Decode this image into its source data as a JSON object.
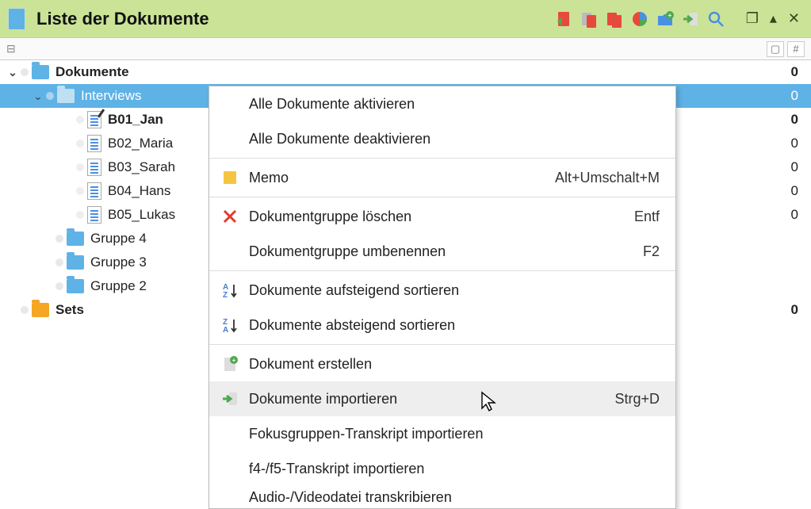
{
  "header": {
    "title": "Liste der Dokumente"
  },
  "tree": {
    "root": {
      "label": "Dokumente",
      "count": "0"
    },
    "interviews": {
      "label": "Interviews",
      "count": "0"
    },
    "docs": [
      {
        "label": "B01_Jan",
        "count": "0",
        "bold": true,
        "edit": true
      },
      {
        "label": "B02_Maria",
        "count": "0"
      },
      {
        "label": "B03_Sarah",
        "count": "0"
      },
      {
        "label": "B04_Hans",
        "count": "0"
      },
      {
        "label": "B05_Lukas",
        "count": "0"
      }
    ],
    "groups": [
      {
        "label": "Gruppe 4"
      },
      {
        "label": "Gruppe 3"
      },
      {
        "label": "Gruppe 2"
      }
    ],
    "sets": {
      "label": "Sets",
      "count": "0"
    }
  },
  "context_menu": {
    "items": [
      {
        "label": "Alle Dokumente aktivieren",
        "shortcut": "",
        "icon": ""
      },
      {
        "label": "Alle Dokumente deaktivieren",
        "shortcut": "",
        "icon": ""
      },
      {
        "sep": true
      },
      {
        "label": "Memo",
        "shortcut": "Alt+Umschalt+M",
        "icon": "memo"
      },
      {
        "sep": true
      },
      {
        "label": "Dokumentgruppe löschen",
        "shortcut": "Entf",
        "icon": "delete"
      },
      {
        "label": "Dokumentgruppe umbenennen",
        "shortcut": "F2",
        "icon": ""
      },
      {
        "sep": true
      },
      {
        "label": "Dokumente aufsteigend sortieren",
        "shortcut": "",
        "icon": "sort-asc"
      },
      {
        "label": "Dokumente absteigend sortieren",
        "shortcut": "",
        "icon": "sort-desc"
      },
      {
        "sep": true
      },
      {
        "label": "Dokument erstellen",
        "shortcut": "",
        "icon": "new-doc"
      },
      {
        "label": "Dokumente importieren",
        "shortcut": "Strg+D",
        "icon": "import",
        "highlight": true
      },
      {
        "label": "Fokusgruppen-Transkript importieren",
        "shortcut": "",
        "icon": ""
      },
      {
        "label": "f4-/f5-Transkript importieren",
        "shortcut": "",
        "icon": ""
      },
      {
        "label": "Audio-/Videodatei transkribieren",
        "shortcut": "",
        "icon": "",
        "cut": true
      }
    ]
  }
}
